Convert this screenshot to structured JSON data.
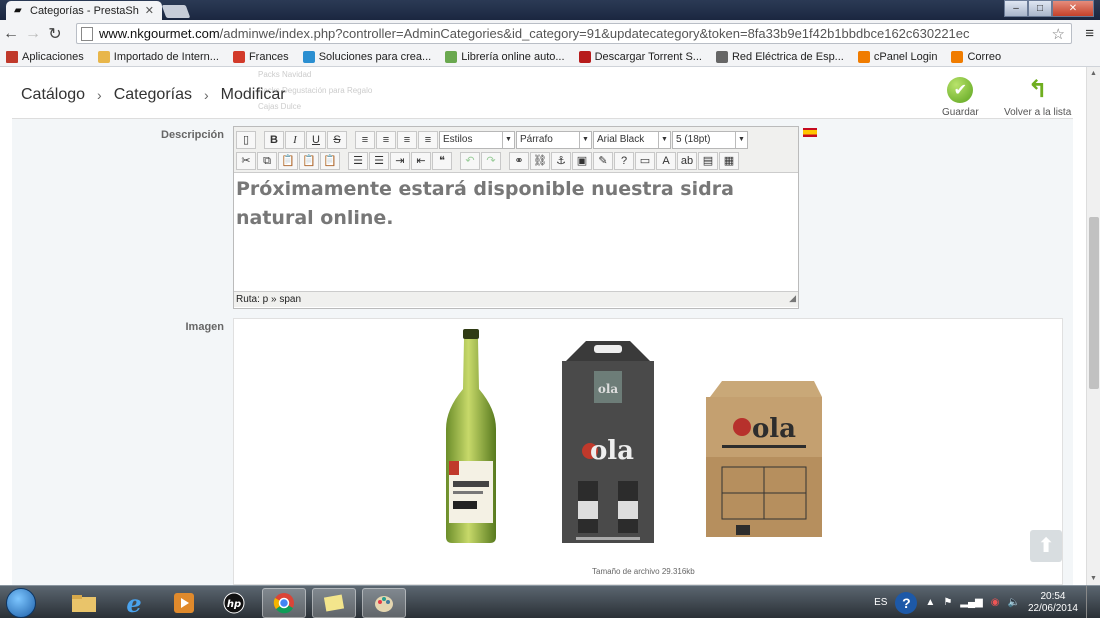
{
  "browser": {
    "tab_title": "Categorías - PrestaShop™",
    "close_glyph": "✕",
    "url_domain": "www.nkgourmet.com",
    "url_path": "/adminwe/index.php?controller=AdminCategories&id_category=91&updatecategory&token=8fa33b9e1f42b1bbdbce162c630221ec",
    "back_glyph": "←",
    "forward_glyph": "→",
    "reload_glyph": "↻",
    "star_glyph": "☆",
    "menu_glyph": "≡",
    "win_min": "–",
    "win_max": "□",
    "win_close": "✕"
  },
  "bookmarks": [
    {
      "label": "Aplicaciones",
      "icon": "apps-icon",
      "color": "#c0392b"
    },
    {
      "label": "Importado de Intern...",
      "icon": "folder-icon",
      "color": "#e8b64a"
    },
    {
      "label": "Frances",
      "icon": "flower-icon",
      "color": "#d23a2a"
    },
    {
      "label": "Soluciones para crea...",
      "icon": "ia-icon",
      "color": "#2b8fd1"
    },
    {
      "label": "Librería online auto...",
      "icon": "leaf-icon",
      "color": "#6aa84f"
    },
    {
      "label": "Descargar Torrent S...",
      "icon": "torrent-icon",
      "color": "#b71c1c"
    },
    {
      "label": "Red Eléctrica de Esp...",
      "icon": "globe-icon",
      "color": "#666666"
    },
    {
      "label": "cPanel Login",
      "icon": "cpanel-icon",
      "color": "#f07c00"
    },
    {
      "label": "Correo",
      "icon": "cpanel-icon",
      "color": "#f07c00"
    }
  ],
  "header": {
    "breadcrumb": [
      "Catálogo",
      "Categorías",
      "Modificar"
    ],
    "breadcrumb_sep": "›",
    "ghost_items": [
      "Packs Navidad",
      "Packs Degustación para Regalo",
      "Cajas Dulce"
    ],
    "save_label": "Guardar",
    "back_label": "Volver a la lista",
    "save_glyph": "✔",
    "back_glyph": "↰"
  },
  "form": {
    "description_label": "Descripción",
    "image_label": "Imagen",
    "styles_select": "Estilos",
    "format_select": "Párrafo",
    "font_select": "Arial Black",
    "size_select": "5 (18pt)",
    "editor_text": "Próximamente estará disponible nuestra sidra natural online.",
    "path_status": "Ruta: p » span",
    "file_size": "Tamaño de archivo 29.316kb",
    "toolbar_row1": [
      "",
      "B",
      "I",
      "U",
      "S",
      "≡",
      "≡",
      "≡",
      "≡"
    ],
    "toolbar_row2": [
      "✂",
      "⧉",
      "📋",
      "📋",
      "📋",
      "☰",
      "☰",
      "⇥",
      "⇤",
      "❝",
      "↶",
      "↷",
      "⚭",
      "⛓",
      "⚓",
      "▣",
      "✎",
      "?",
      "▭",
      "A",
      "ab",
      "▤",
      "▦"
    ]
  },
  "taskbar": {
    "language": "ES",
    "time": "20:54",
    "date": "22/06/2014",
    "help_glyph": "?",
    "up_glyph": "⬆"
  },
  "colors": {
    "accent_green": "#6fae1f",
    "page_bg": "#f3f6f8"
  }
}
